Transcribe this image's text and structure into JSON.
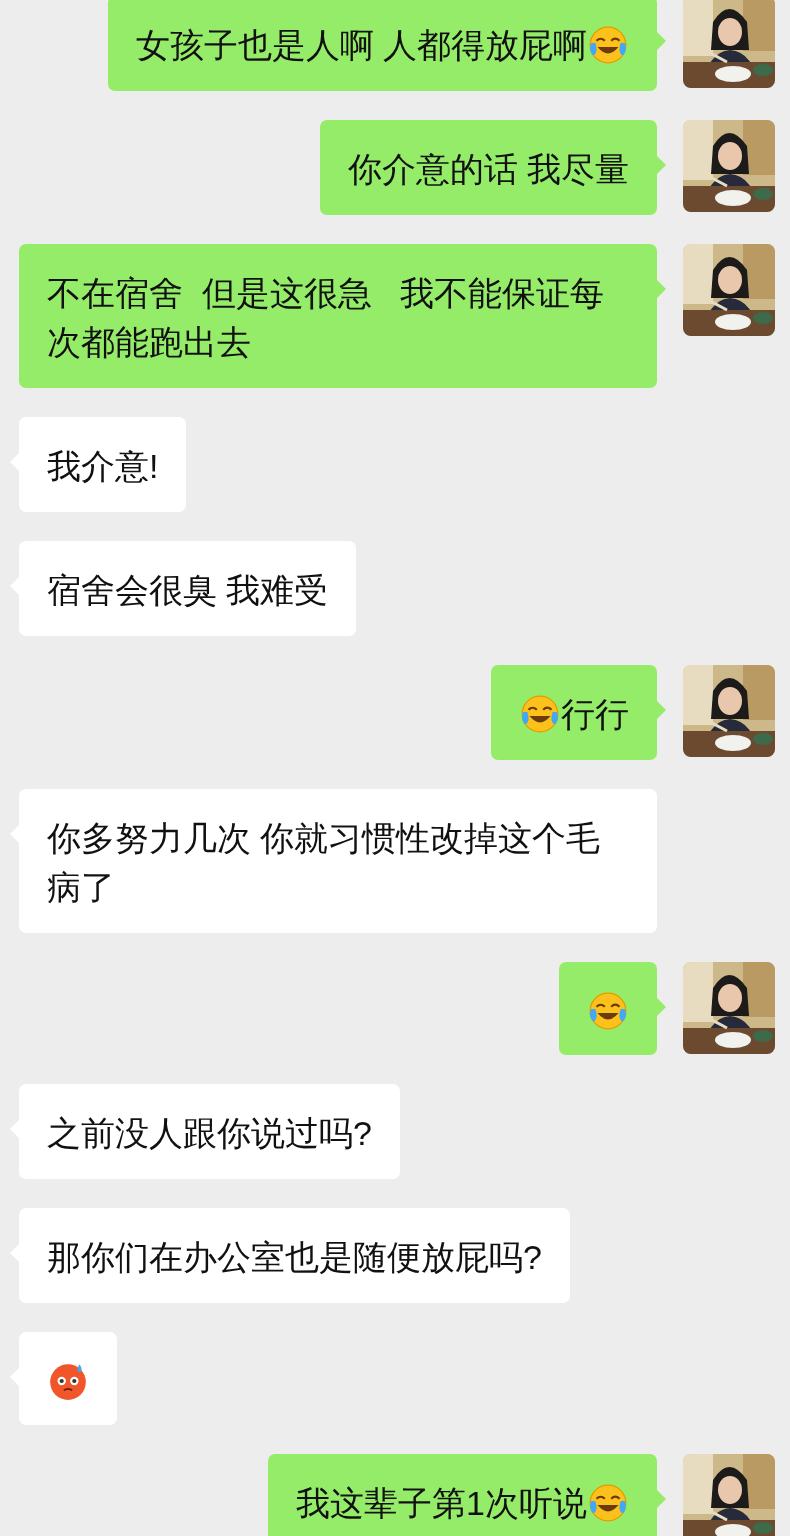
{
  "messages": [
    {
      "kind": "sent",
      "parts": [
        {
          "kind": "text",
          "text": "女孩子也是人啊 人都得放屁啊"
        },
        {
          "kind": "laughcry"
        }
      ]
    },
    {
      "kind": "sent",
      "parts": [
        {
          "kind": "text",
          "text": "你介意的话 我尽量"
        }
      ]
    },
    {
      "kind": "sent",
      "parts": [
        {
          "kind": "text",
          "text": "不在宿舍  但是这很急   我不能保证每次都能跑出去"
        }
      ]
    },
    {
      "kind": "received",
      "parts": [
        {
          "kind": "text",
          "text": "我介意!"
        }
      ]
    },
    {
      "kind": "received",
      "parts": [
        {
          "kind": "text",
          "text": "宿舍会很臭 我难受"
        }
      ]
    },
    {
      "kind": "sent",
      "parts": [
        {
          "kind": "laughcry"
        },
        {
          "kind": "text",
          "text": "行行"
        }
      ]
    },
    {
      "kind": "received",
      "parts": [
        {
          "kind": "text",
          "text": "你多努力几次 你就习惯性改掉这个毛病了"
        }
      ]
    },
    {
      "kind": "sent",
      "parts": [
        {
          "kind": "laughcry"
        }
      ]
    },
    {
      "kind": "received",
      "parts": [
        {
          "kind": "text",
          "text": "之前没人跟你说过吗?"
        }
      ]
    },
    {
      "kind": "received",
      "parts": [
        {
          "kind": "text",
          "text": "那你们在办公室也是随便放屁吗?"
        }
      ]
    },
    {
      "kind": "received",
      "parts": [
        {
          "kind": "sweat"
        }
      ]
    },
    {
      "kind": "sent",
      "parts": [
        {
          "kind": "text",
          "text": "我这辈子第1次听说"
        },
        {
          "kind": "laughcry"
        }
      ]
    }
  ]
}
